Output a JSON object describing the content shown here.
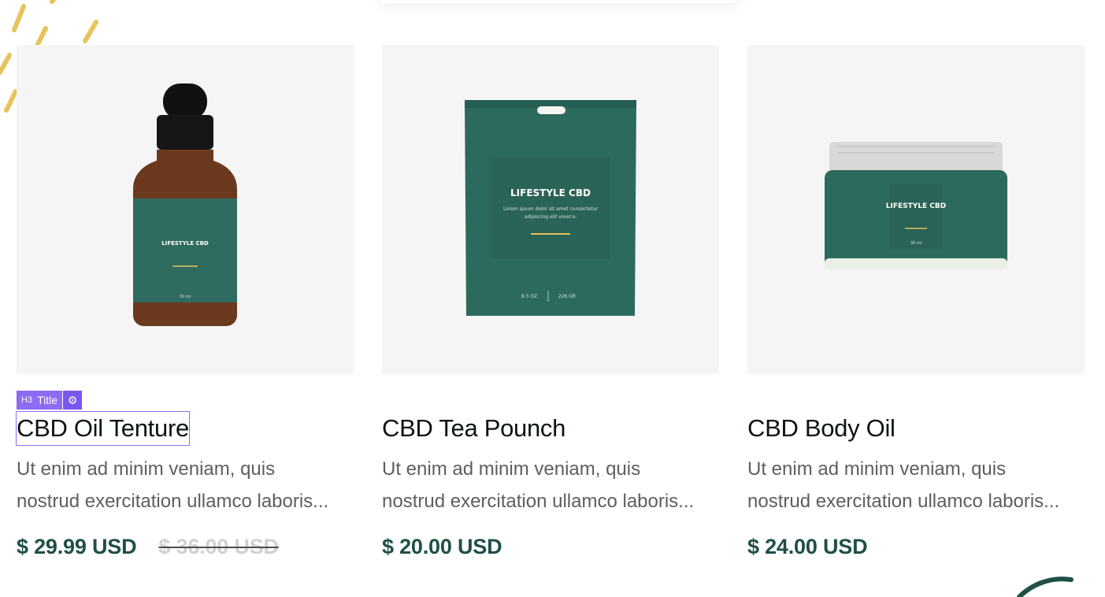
{
  "editor_badge": {
    "tag": "H3",
    "label": "Title",
    "gear_icon": "gear-icon"
  },
  "colors": {
    "price": "#1f4f47",
    "accent": "#8e6bf2",
    "label_green": "#2f6b5f",
    "deco_gold": "#e8c35a"
  },
  "products": [
    {
      "title": "CBD Oil Tenture",
      "desc_line1": "Ut enim ad minim veniam, quis",
      "desc_line2": "nostrud exercitation ullamco laboris...",
      "price": "$ 29.99 USD",
      "old_price": "$ 36.00 USD",
      "image": "dropper-bottle-image",
      "label": {
        "brand": "LIFESTYLE CBD",
        "size": "30 ml"
      }
    },
    {
      "title": "CBD Tea Pounch",
      "desc_line1": "Ut enim ad minim veniam, quis",
      "desc_line2": "nostrud exercitation ullamco laboris...",
      "price": "$ 20.00 USD",
      "image": "tea-pouch-image",
      "label": {
        "brand": "LIFESTYLE CBD",
        "line1": "Lorem ipsum dolor sit amet consectetur",
        "line2": "adipiscing elit viverra.",
        "oz": "8.5 OZ",
        "gr": "226 GR"
      }
    },
    {
      "title": "CBD Body Oil",
      "desc_line1": "Ut enim ad minim veniam, quis",
      "desc_line2": "nostrud exercitation ullamco laboris...",
      "price": "$ 24.00 USD",
      "image": "cream-jar-image",
      "label": {
        "brand": "LIFESTYLE CBD",
        "size": "30 ml"
      }
    }
  ]
}
